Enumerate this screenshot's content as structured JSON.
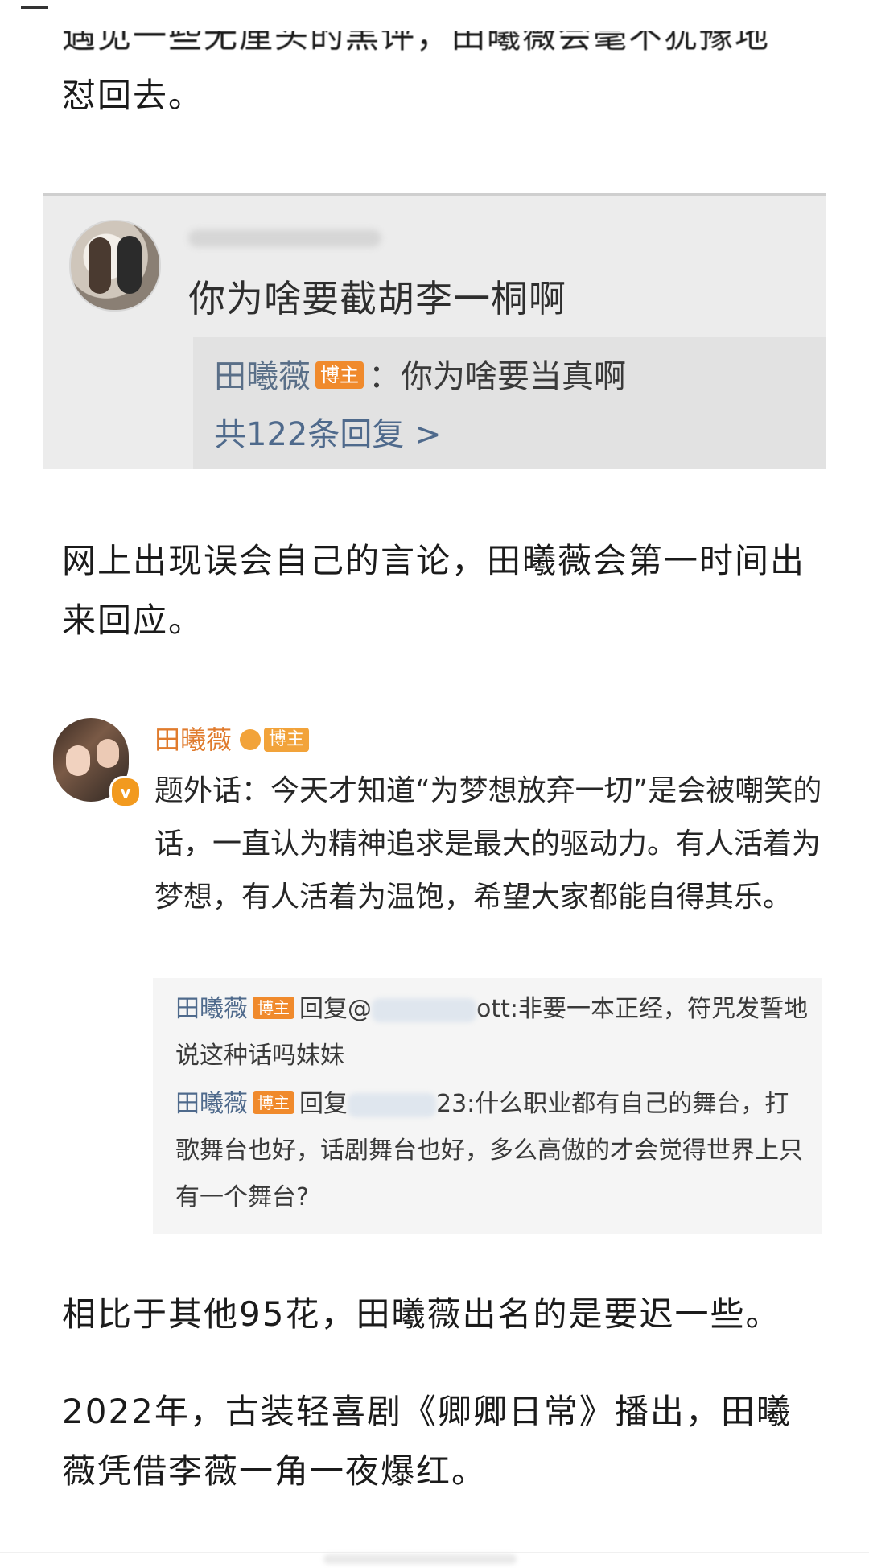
{
  "article": {
    "para_top_line1": "遇见一些无厘头的黑评，田曦薇会毫不犹豫地",
    "para_top_line2": "怼回去。",
    "para_2": "网上出现误会自己的言论，田曦薇会第一时间出来回应。",
    "para_3": "相比于其他95花，田曦薇出名的是要迟一些。",
    "para_4": "2022年，古装轻喜剧《卿卿日常》播出，田曦薇凭借李薇一角一夜爆红。"
  },
  "screenshot_1": {
    "comment": "你为啥要截胡李一桐啊",
    "reply_author": "田曦薇",
    "reply_badge": "博主",
    "reply_text": "：你为啥要当真啊",
    "reply_count": "共122条回复 >"
  },
  "screenshot_2": {
    "author": "田曦薇",
    "author_badge": "博主",
    "verified_mark": "v",
    "post_text": "题外话：今天才知道“为梦想放弃一切”是会被嘲笑的话，一直认为精神追求是最大的驱动力。有人活着为梦想，有人活着为温饱，希望大家都能自得其乐。",
    "replies": [
      {
        "author": "田曦薇",
        "badge": "博主",
        "prefix": "回复@",
        "suffix": "ott:非要一本正经，符咒发誓地说这种话吗妹妹"
      },
      {
        "author": "田曦薇",
        "badge": "博主",
        "prefix": "回复",
        "suffix": "23:什么职业都有自己的舞台，打歌舞台也好，话剧舞台也好，多么高傲的才会觉得世界上只有一个舞台?"
      }
    ]
  },
  "colors": {
    "name_blue": "#4f6a8c",
    "badge_orange": "#f08a2c",
    "name_orange": "#e07b2d"
  }
}
